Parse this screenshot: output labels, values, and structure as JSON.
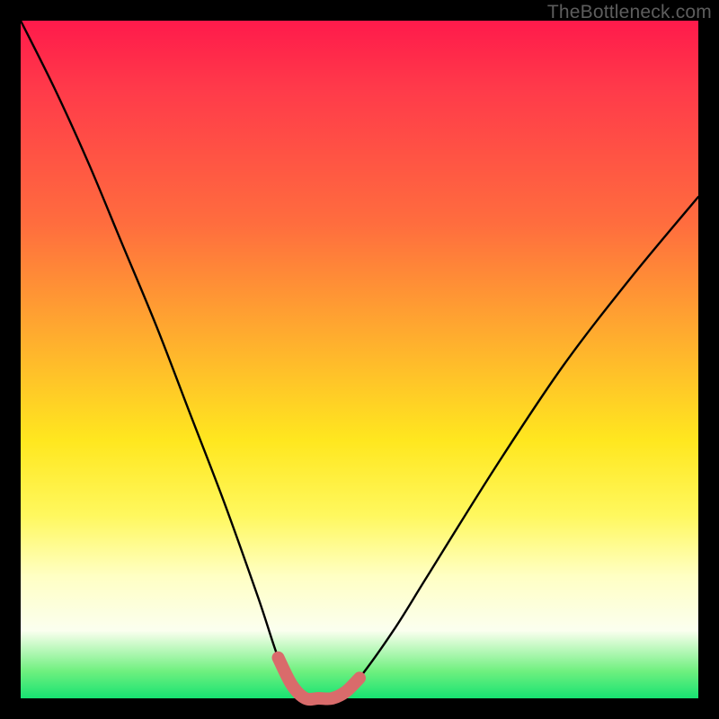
{
  "watermark": "TheBottleneck.com",
  "chart_data": {
    "type": "line",
    "title": "",
    "xlabel": "",
    "ylabel": "",
    "xlim": [
      0,
      1
    ],
    "ylim": [
      0,
      1
    ],
    "series": [
      {
        "name": "bottleneck-curve",
        "x": [
          0.0,
          0.05,
          0.1,
          0.15,
          0.2,
          0.25,
          0.3,
          0.35,
          0.38,
          0.4,
          0.42,
          0.44,
          0.46,
          0.48,
          0.5,
          0.55,
          0.6,
          0.7,
          0.8,
          0.9,
          1.0
        ],
        "values": [
          1.0,
          0.9,
          0.79,
          0.67,
          0.55,
          0.42,
          0.29,
          0.15,
          0.06,
          0.02,
          0.0,
          0.0,
          0.0,
          0.01,
          0.03,
          0.1,
          0.18,
          0.34,
          0.49,
          0.62,
          0.74
        ]
      }
    ],
    "annotations": [
      {
        "name": "valley-highlight",
        "x_range": [
          0.37,
          0.5
        ],
        "y_approx": 0.02,
        "color": "#d96b6b"
      }
    ],
    "gradient_stops": [
      {
        "pos": 0.0,
        "color": "#ff1a4b"
      },
      {
        "pos": 0.3,
        "color": "#ff6d3e"
      },
      {
        "pos": 0.62,
        "color": "#ffe71f"
      },
      {
        "pos": 0.9,
        "color": "#fbffef"
      },
      {
        "pos": 1.0,
        "color": "#17e272"
      }
    ]
  }
}
